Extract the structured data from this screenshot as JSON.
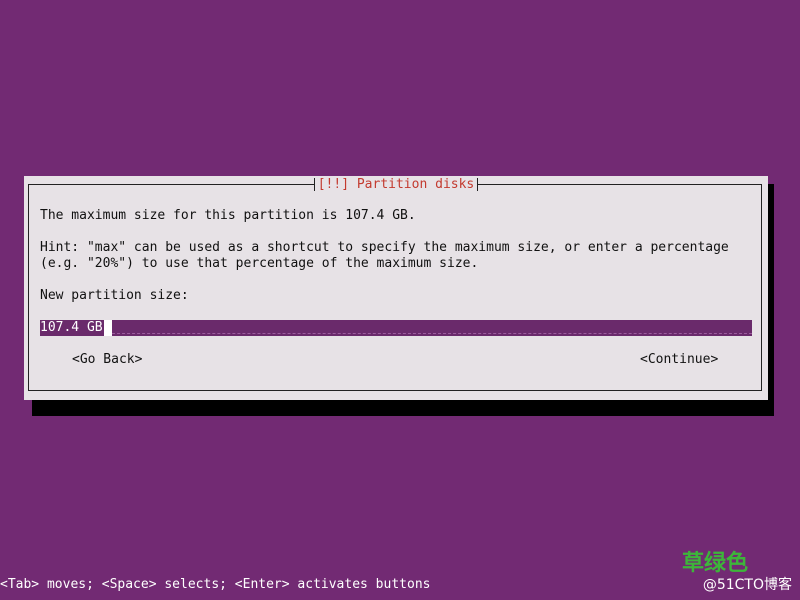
{
  "dialog": {
    "title": "[!!] Partition disks",
    "message": "The maximum size for this partition is 107.4 GB.",
    "hint_line1": "Hint: \"max\" can be used as a shortcut to specify the maximum size, or enter a percentage",
    "hint_line2": "(e.g. \"20%\") to use that percentage of the maximum size.",
    "field_label": "New partition size:",
    "field_value": "107.4 GB",
    "go_back_label": "<Go Back>",
    "continue_label": "<Continue>"
  },
  "status_bar": {
    "text": "<Tab> moves; <Space> selects; <Enter> activates buttons"
  },
  "watermark": {
    "top": "草绿色",
    "bottom": "@51CTO博客"
  },
  "colors": {
    "background": "#722a73",
    "dialog_bg": "#e7e2e6",
    "title_red": "#c33a2f",
    "input_bg": "#6a2a6b"
  }
}
